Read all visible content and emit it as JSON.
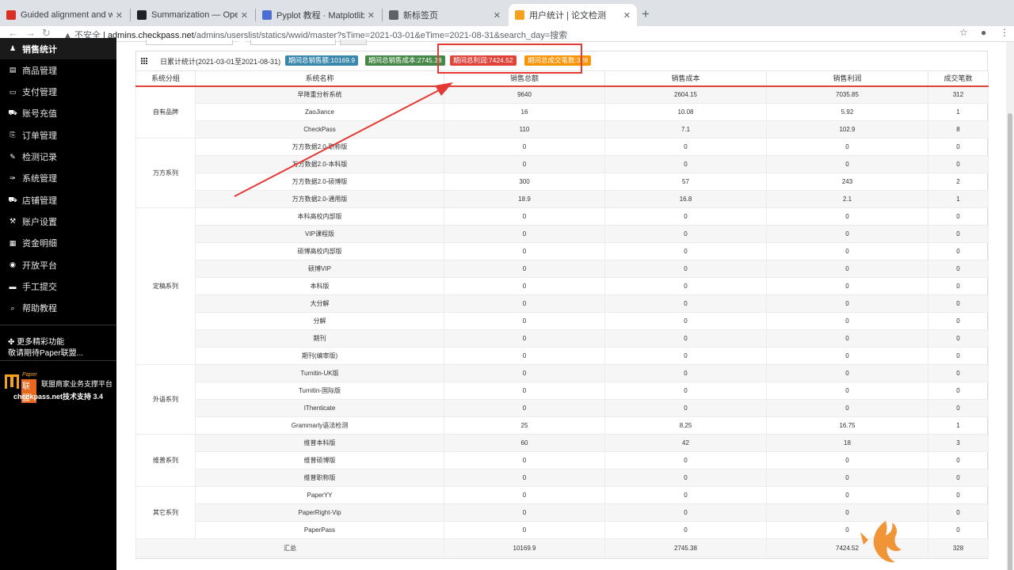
{
  "browser": {
    "tabs": [
      {
        "title": "Guided alignment and weighted",
        "icon": "bookmark-icon",
        "color": "#d93025"
      },
      {
        "title": "Summarization — OpenNMT-py",
        "icon": "github-icon",
        "color": "#202124"
      },
      {
        "title": "Pyplot 教程 · Matplotlib 用户指南",
        "icon": "matplotlib-icon",
        "color": "#4b6fd3"
      },
      {
        "title": "新标签页",
        "icon": "chrome-icon",
        "color": "#5f6368"
      },
      {
        "title": "用户统计 | 论文检测",
        "icon": "checkpass-icon",
        "color": "#f4a21d"
      }
    ],
    "address": {
      "security": "不安全",
      "host": "admins.checkpass.net",
      "path": "/admins/userslist/statics/wwid/master?sTime=2021-03-01&eTime=2021-08-31&search_day=搜索"
    }
  },
  "sidebar": {
    "items": [
      {
        "label": "销售统计",
        "icon": "user-icon"
      },
      {
        "label": "商品管理",
        "icon": "list-icon"
      },
      {
        "label": "支付管理",
        "icon": "card-icon"
      },
      {
        "label": "账号充值",
        "icon": "cart-icon"
      },
      {
        "label": "订单管理",
        "icon": "copy-icon"
      },
      {
        "label": "检测记录",
        "icon": "edit-icon"
      },
      {
        "label": "系统管理",
        "icon": "wrench-icon"
      },
      {
        "label": "店铺管理",
        "icon": "truck-icon"
      },
      {
        "label": "账户设置",
        "icon": "tool-icon"
      },
      {
        "label": "资金明细",
        "icon": "table-icon"
      },
      {
        "label": "开放平台",
        "icon": "globe-icon"
      },
      {
        "label": "手工提交",
        "icon": "folder-icon"
      },
      {
        "label": "帮助教程",
        "icon": "search-icon"
      }
    ],
    "more_title": "更多精彩功能",
    "more_sub": "敬请期待Paper联盟...",
    "brand_paper": "Paper",
    "brand_lm": "联盟",
    "brand_text": "联盟商家业务支撑平台",
    "brand_support": "checkpass.net技术支持 3.4"
  },
  "panel": {
    "title": "日累计统计(2021-03-01至2021-08-31)",
    "badges": [
      {
        "label": "期间总销售额:10169.9",
        "color": "#3a87ad"
      },
      {
        "label": "期间总销售成本:2745.38",
        "color": "#468847"
      },
      {
        "label": "期间总利润:7424.52",
        "color": "#e0433a"
      },
      {
        "label": "期间总成交笔数:328",
        "color": "#f89406"
      }
    ]
  },
  "table": {
    "headers": [
      "系统分组",
      "系统名称",
      "销售总额",
      "销售成本",
      "销售利润",
      "成交笔数"
    ],
    "groups": [
      {
        "name": "自有品牌",
        "rows": [
          [
            "早降重分析系统",
            "9640",
            "2604.15",
            "7035.85",
            "312"
          ],
          [
            "ZaoJiance",
            "16",
            "10.08",
            "5.92",
            "1"
          ],
          [
            "CheckPass",
            "110",
            "7.1",
            "102.9",
            "8"
          ]
        ]
      },
      {
        "name": "万方系列",
        "rows": [
          [
            "万方数据2.0-职称版",
            "0",
            "0",
            "0",
            "0"
          ],
          [
            "万方数据2.0-本科版",
            "0",
            "0",
            "0",
            "0"
          ],
          [
            "万方数据2.0-硕博版",
            "300",
            "57",
            "243",
            "2"
          ],
          [
            "万方数据2.0-通用版",
            "18.9",
            "16.8",
            "2.1",
            "1"
          ]
        ]
      },
      {
        "name": "定稿系列",
        "rows": [
          [
            "本科高校内部版",
            "0",
            "0",
            "0",
            "0"
          ],
          [
            "VIP课程版",
            "0",
            "0",
            "0",
            "0"
          ],
          [
            "硕博高校内部版",
            "0",
            "0",
            "0",
            "0"
          ],
          [
            "硕博VIP",
            "0",
            "0",
            "0",
            "0"
          ],
          [
            "本科版",
            "0",
            "0",
            "0",
            "0"
          ],
          [
            "大分解",
            "0",
            "0",
            "0",
            "0"
          ],
          [
            "分解",
            "0",
            "0",
            "0",
            "0"
          ],
          [
            "期刊",
            "0",
            "0",
            "0",
            "0"
          ],
          [
            "期刊(编审版)",
            "0",
            "0",
            "0",
            "0"
          ]
        ]
      },
      {
        "name": "外语系列",
        "rows": [
          [
            "Turnitin-UK版",
            "0",
            "0",
            "0",
            "0"
          ],
          [
            "Turnitin-国际版",
            "0",
            "0",
            "0",
            "0"
          ],
          [
            "IThenticate",
            "0",
            "0",
            "0",
            "0"
          ],
          [
            "Grammarly语法检测",
            "25",
            "8.25",
            "16.75",
            "1"
          ]
        ]
      },
      {
        "name": "维普系列",
        "rows": [
          [
            "维普本科版",
            "60",
            "42",
            "18",
            "3"
          ],
          [
            "维普硕博版",
            "0",
            "0",
            "0",
            "0"
          ],
          [
            "维普职称版",
            "0",
            "0",
            "0",
            "0"
          ]
        ]
      },
      {
        "name": "其它系列",
        "rows": [
          [
            "PaperYY",
            "0",
            "0",
            "0",
            "0"
          ],
          [
            "PaperRight-Vip",
            "0",
            "0",
            "0",
            "0"
          ],
          [
            "PaperPass",
            "0",
            "0",
            "0",
            "0"
          ]
        ]
      }
    ],
    "total": [
      "汇总",
      "10169.9",
      "2745.38",
      "7424.52",
      "328"
    ]
  }
}
